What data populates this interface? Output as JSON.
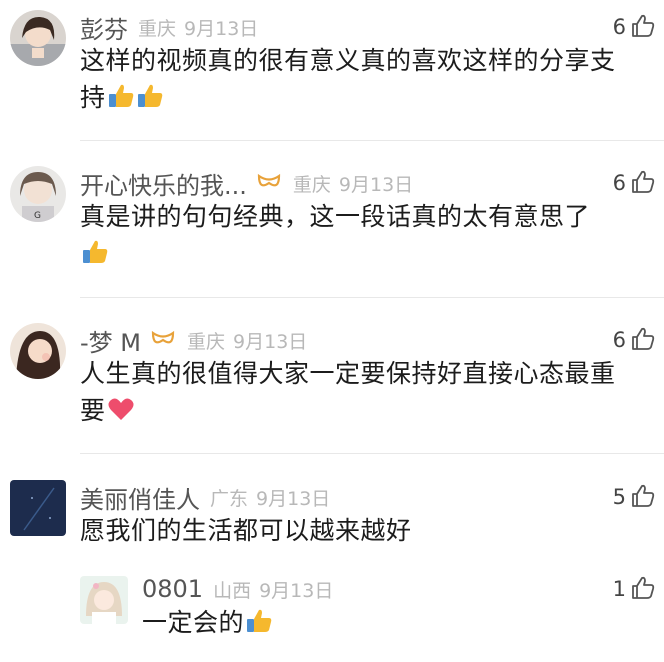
{
  "comments": [
    {
      "username": "彭芬",
      "location": "重庆",
      "date": "9月13日",
      "likes": "6",
      "text": "这样的视频真的很有意义真的喜欢这样的分享支持",
      "emojis": [
        "thumbs-up",
        "thumbs-up"
      ]
    },
    {
      "username": "开心快乐的我...",
      "location": "重庆",
      "date": "9月13日",
      "likes": "6",
      "text": "真是讲的句句经典，这一段话真的太有意思了",
      "emojis": [
        "thumbs-up"
      ]
    },
    {
      "username": "-梦 M",
      "location": "重庆",
      "date": "9月13日",
      "likes": "6",
      "text": "人生真的很值得大家一定要保持好直接心态最重要",
      "emojis": [
        "heart"
      ]
    },
    {
      "username": "美丽俏佳人",
      "location": "广东",
      "date": "9月13日",
      "likes": "5",
      "text": "愿我们的生活都可以越来越好",
      "emojis": []
    }
  ],
  "reply": {
    "username": "0801",
    "location": "山西",
    "date": "9月13日",
    "likes": "1",
    "text": "一定会的",
    "emojis": [
      "thumbs-up"
    ]
  },
  "colors": {
    "username": "#555555",
    "meta": "#b8b8b8",
    "badge": "#e8a23a",
    "thumb_emoji": "#f5b82e",
    "heart_emoji": "#ee4d6c"
  }
}
